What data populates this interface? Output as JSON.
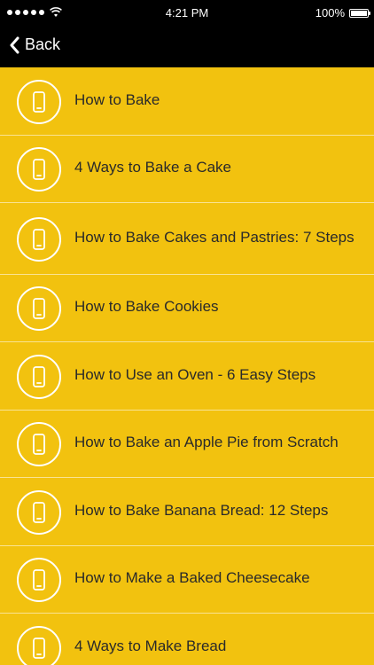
{
  "status_bar": {
    "time": "4:21 PM",
    "battery": "100%"
  },
  "nav": {
    "back_label": "Back"
  },
  "list": {
    "items": [
      {
        "label": "How to Bake"
      },
      {
        "label": "4 Ways to Bake a Cake"
      },
      {
        "label": "How to Bake Cakes and Pastries: 7 Steps"
      },
      {
        "label": "How to Bake Cookies"
      },
      {
        "label": "How to Use an Oven - 6 Easy Steps"
      },
      {
        "label": "How to Bake an Apple Pie from Scratch"
      },
      {
        "label": "How to Bake Banana Bread: 12 Steps"
      },
      {
        "label": "How to Make a Baked Cheesecake"
      },
      {
        "label": "4 Ways to Make Bread"
      }
    ]
  },
  "colors": {
    "background": "#f2c20f",
    "bars": "#000000",
    "text": "#2a2a2a",
    "icon": "#ffffff"
  }
}
